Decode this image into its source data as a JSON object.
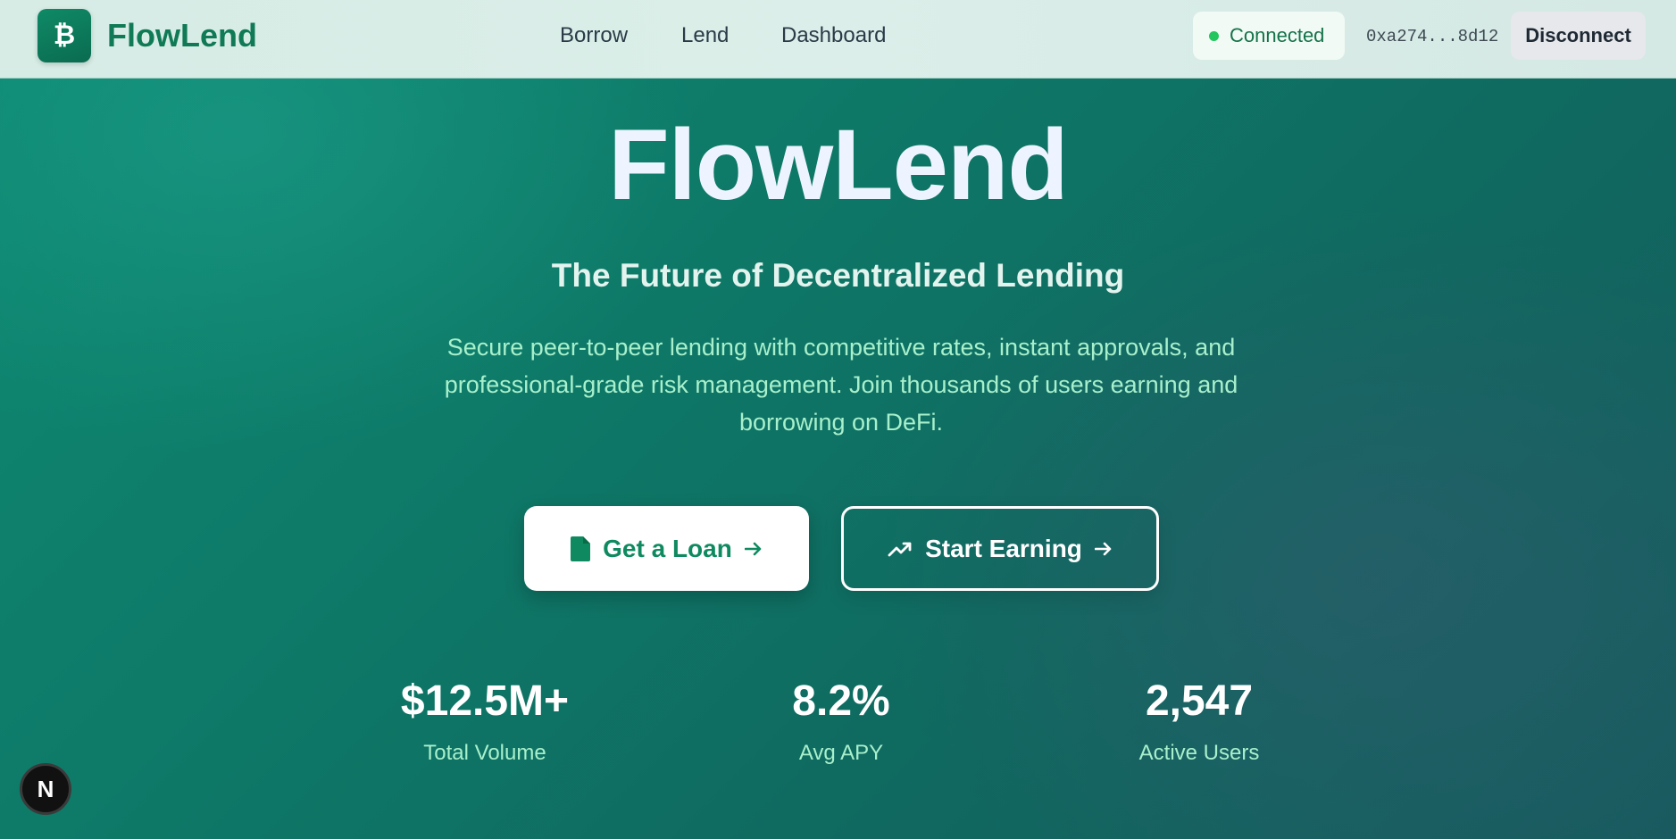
{
  "brand": {
    "logo_glyph": "₿",
    "name": "FlowLend"
  },
  "nav": {
    "items": [
      {
        "label": "Borrow"
      },
      {
        "label": "Lend"
      },
      {
        "label": "Dashboard"
      }
    ]
  },
  "wallet": {
    "status": "Connected",
    "status_color": "#22c55e",
    "address": "0xa274...8d12",
    "disconnect_label": "Disconnect"
  },
  "hero": {
    "title": "FlowLend",
    "subtitle": "The Future of Decentralized Lending",
    "description": "Secure peer-to-peer lending with competitive rates, instant approvals, and professional-grade risk management. Join thousands of users earning and borrowing on DeFi."
  },
  "actions": {
    "loan": {
      "label": "Get a Loan",
      "icon": "document-icon"
    },
    "earn": {
      "label": "Start Earning",
      "icon": "trending-up-icon"
    }
  },
  "stats": [
    {
      "value": "$12.5M+",
      "label": "Total Volume"
    },
    {
      "value": "8.2%",
      "label": "Avg APY"
    },
    {
      "value": "2,547",
      "label": "Active Users"
    }
  ],
  "dev_badge": {
    "label": "N"
  },
  "colors": {
    "brand": "#0f7a55",
    "accent_text": "#a8f0cc"
  }
}
